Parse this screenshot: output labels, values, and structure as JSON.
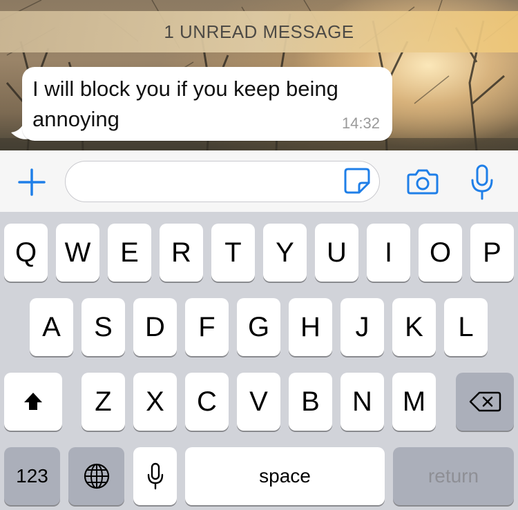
{
  "chat": {
    "unread_banner": "1 UNREAD MESSAGE",
    "message": {
      "text": "I will block you if you keep being annoying",
      "time": "14:32"
    }
  },
  "input_bar": {
    "text_value": "",
    "icons": [
      "plus-icon",
      "sticker-icon",
      "camera-icon",
      "microphone-icon"
    ],
    "accent_color": "#1f7fe8"
  },
  "keyboard": {
    "row1": [
      "Q",
      "W",
      "E",
      "R",
      "T",
      "Y",
      "U",
      "I",
      "O",
      "P"
    ],
    "row2": [
      "A",
      "S",
      "D",
      "F",
      "G",
      "H",
      "J",
      "K",
      "L"
    ],
    "row3": [
      "Z",
      "X",
      "C",
      "V",
      "B",
      "N",
      "M"
    ],
    "numbers_label": "123",
    "space_label": "space",
    "return_label": "return",
    "icons": [
      "shift-icon",
      "backspace-icon",
      "globe-icon",
      "dictation-icon"
    ]
  }
}
